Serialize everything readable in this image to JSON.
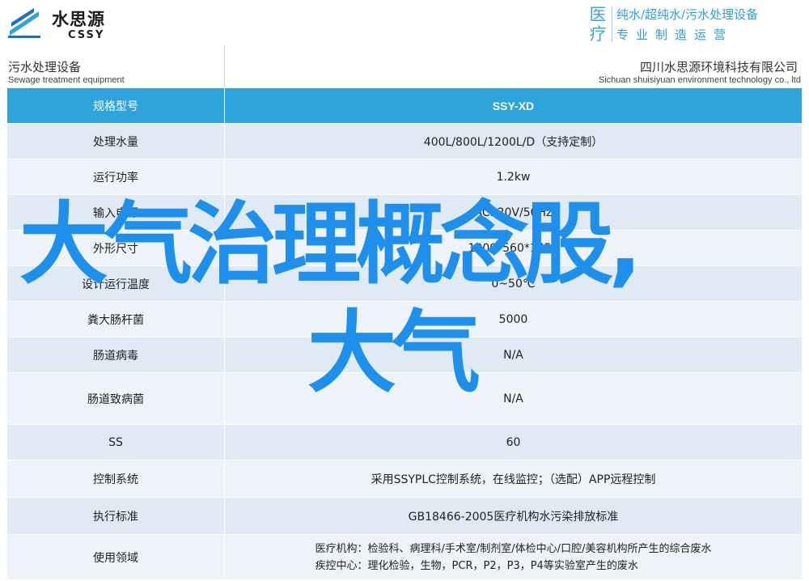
{
  "header": {
    "logo_cn": "水思源",
    "logo_en": "CSSY",
    "tag_big": "医疗",
    "tag_line1": "纯水/超纯水/污水处理设备",
    "tag_line2": "专业制造运营",
    "accent_color": "#2ea4dc"
  },
  "band": {
    "left_cn": "污水处理设备",
    "left_en": "Sewage treatment equipment",
    "right_cn": "四川水思源环境科技有限公司",
    "right_en": "Sichuan shuisiyuan environment technology co., ltd"
  },
  "table": {
    "header": {
      "label": "规格型号",
      "value": "SSY-XD"
    },
    "rows": [
      {
        "label": "处理水量",
        "value": "400L/800L/1200L/D（支持定制）"
      },
      {
        "label": "运行功率",
        "value": "1.2kw"
      },
      {
        "label": "输入电源",
        "value": "AC220V/50Hz"
      },
      {
        "label": "外形尺寸",
        "value": "1000*560*1450"
      },
      {
        "label": "设计运行温度",
        "value": "0~50℃"
      },
      {
        "label": "粪大肠杆菌",
        "value": "5000"
      },
      {
        "label": "肠道病毒",
        "value": "N/A"
      },
      {
        "label": "肠道致病菌",
        "value": "N/A"
      },
      {
        "label": "SS",
        "value": "60"
      },
      {
        "label": "控制系统",
        "value": "采用SSYPLC控制系统，在线监控；（选配）APP远程控制"
      },
      {
        "label": "执行标准",
        "value": "GB18466-2005医疗机构水污染排放标准"
      },
      {
        "label": "使用领域",
        "value_line1": "医疗机构：检验科、病理科/手术室/制剂室/体检中心/口腔/美容机构所产生的综合废水",
        "value_line2": "疾控中心：理化检验，生物，PCR，P2，P3，P4等实验室产生的废水"
      }
    ]
  },
  "overlay": {
    "line1": "大气治理概念股,",
    "line2": "大气",
    "color": "#1f8fec"
  }
}
